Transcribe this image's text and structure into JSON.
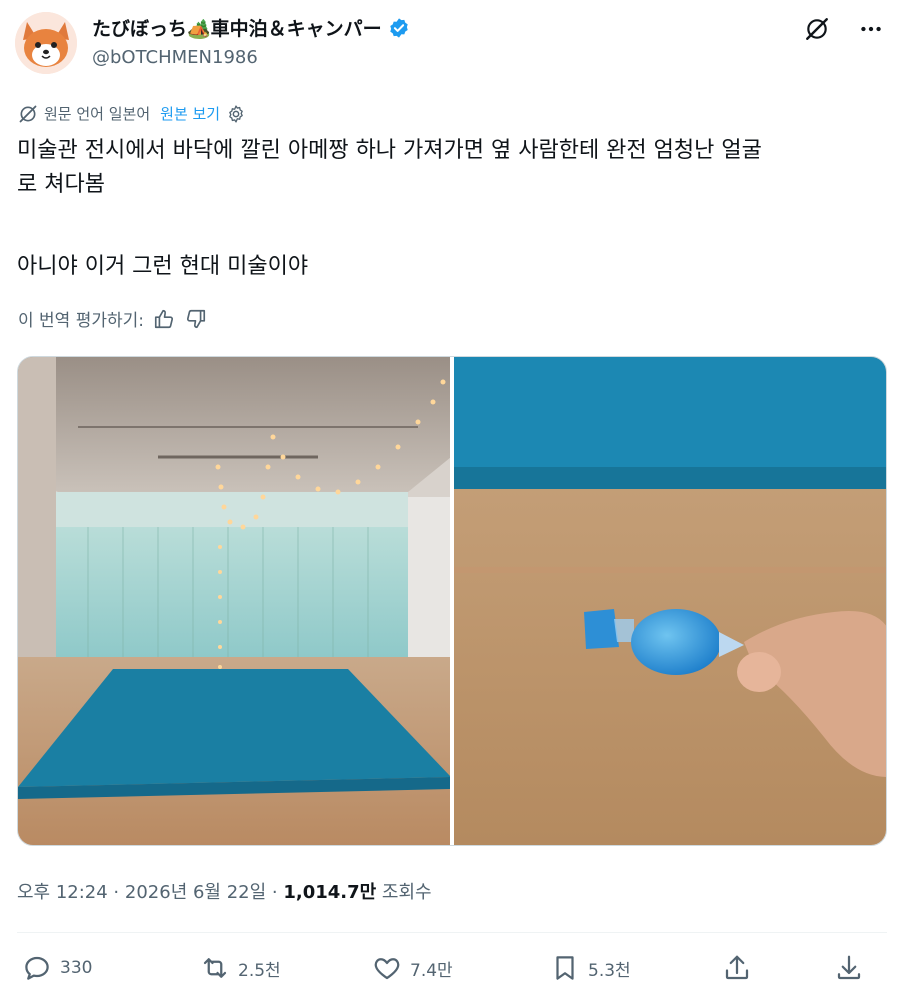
{
  "author": {
    "display_name": "たびぼっち🏕️車中泊＆キャンパー",
    "handle": "@bOTCHMEN1986",
    "verified": true,
    "avatar_icon": "fox-avatar"
  },
  "top_bar": {
    "grok_icon": "grok-icon",
    "more_icon": "more-dots-icon"
  },
  "translation": {
    "label": "원문 언어 일본어",
    "show_original": "원본 보기",
    "rate_label": "이 번역 평가하기:"
  },
  "post": {
    "line1": "미술관 전시에서 바닥에 깔린 아메짱 하나 가져가면 옆 사람한테 완전 엄청난 얼굴",
    "line2": "로 쳐다봄",
    "line3": "아니야 이거 그런 현대 미술이야"
  },
  "meta": {
    "time": "오후 12:24 · 2026년 6월 22일 · ",
    "views_count": "1,014.7만",
    "views_label": " 조회수"
  },
  "actions": {
    "replies": "330",
    "reposts": "2.5천",
    "likes": "7.4만",
    "bookmarks": "5.3천"
  },
  "colors": {
    "accent": "#1d9bf0",
    "secondary_text": "#536471",
    "carpet": "#1a8ab0"
  }
}
